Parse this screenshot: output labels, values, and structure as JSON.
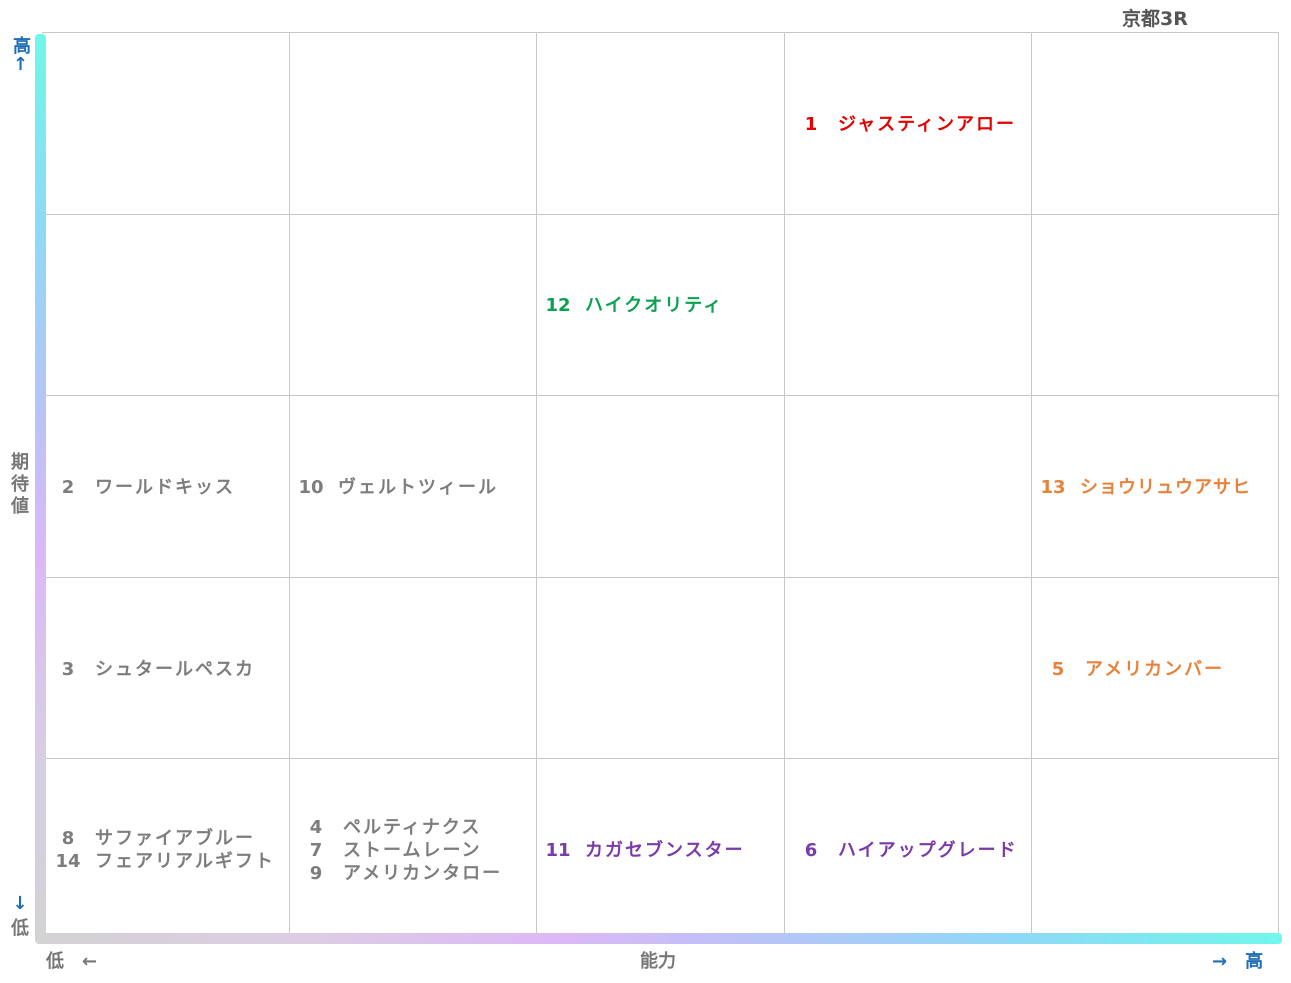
{
  "title": "京都3R",
  "axes": {
    "y_high": "高↑",
    "y_label": [
      "期",
      "待",
      "値"
    ],
    "y_low_arrow": "↓",
    "y_low": "低",
    "x_low": "低　←",
    "x_label": "能力",
    "x_high": "→　高"
  },
  "colors": {
    "red": "#e30000",
    "green": "#0aa150",
    "gray": "#7d7d7d",
    "orange": "#e8823a",
    "purple": "#7a3aa8"
  },
  "horses": [
    {
      "num": "1",
      "name": "ジャスティンアロー",
      "ability_col": 4,
      "expectation_row": 5,
      "color": "red"
    },
    {
      "num": "12",
      "name": "ハイクオリティ",
      "ability_col": 3,
      "expectation_row": 4,
      "color": "green"
    },
    {
      "num": "2",
      "name": "ワールドキッス",
      "ability_col": 1,
      "expectation_row": 3,
      "color": "gray"
    },
    {
      "num": "10",
      "name": "ヴェルトツィール",
      "ability_col": 2,
      "expectation_row": 3,
      "color": "gray"
    },
    {
      "num": "13",
      "name": "ショウリュウアサヒ",
      "ability_col": 5,
      "expectation_row": 3,
      "color": "orange"
    },
    {
      "num": "3",
      "name": "シュタールペスカ",
      "ability_col": 1,
      "expectation_row": 2,
      "color": "gray"
    },
    {
      "num": "5",
      "name": "アメリカンバー",
      "ability_col": 5,
      "expectation_row": 2,
      "color": "orange"
    },
    {
      "num": "8",
      "name": "サファイアブルー",
      "ability_col": 1,
      "expectation_row": 1,
      "color": "gray"
    },
    {
      "num": "14",
      "name": "フェアリアルギフト",
      "ability_col": 1,
      "expectation_row": 1,
      "color": "gray"
    },
    {
      "num": "4",
      "name": "ペルティナクス",
      "ability_col": 2,
      "expectation_row": 1,
      "color": "gray"
    },
    {
      "num": "7",
      "name": "ストームレーン",
      "ability_col": 2,
      "expectation_row": 1,
      "color": "gray"
    },
    {
      "num": "9",
      "name": "アメリカンタロー",
      "ability_col": 2,
      "expectation_row": 1,
      "color": "gray"
    },
    {
      "num": "11",
      "name": "カガセブンスター",
      "ability_col": 3,
      "expectation_row": 1,
      "color": "purple"
    },
    {
      "num": "6",
      "name": "ハイアップグレード",
      "ability_col": 4,
      "expectation_row": 1,
      "color": "purple"
    }
  ]
}
